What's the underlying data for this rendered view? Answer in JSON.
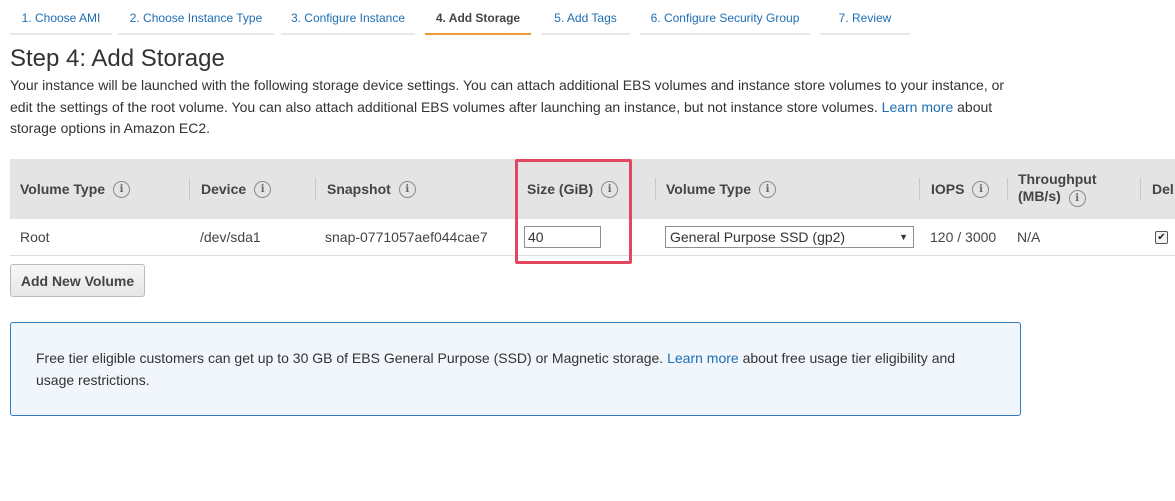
{
  "wizard": {
    "steps": [
      {
        "label": "1. Choose AMI"
      },
      {
        "label": "2. Choose Instance Type"
      },
      {
        "label": "3. Configure Instance"
      },
      {
        "label": "4. Add Storage"
      },
      {
        "label": "5. Add Tags"
      },
      {
        "label": "6. Configure Security Group"
      },
      {
        "label": "7. Review"
      }
    ],
    "active_index": 3
  },
  "page": {
    "title": "Step 4: Add Storage",
    "intro_text_1": "Your instance will be launched with the following storage device settings. You can attach additional EBS volumes and instance store volumes to your instance, or edit the settings of the root volume. You can also attach additional EBS volumes after launching an instance, but not instance store volumes.",
    "intro_link": "Learn more",
    "intro_text_2": "about storage options in Amazon EC2."
  },
  "table": {
    "headers": {
      "volume_type": "Volume Type",
      "device": "Device",
      "snapshot": "Snapshot",
      "size": "Size (GiB)",
      "ebs_volume_type": "Volume Type",
      "iops": "IOPS",
      "throughput_1": "Throughput",
      "throughput_2": "(MB/s)",
      "delete": "Del"
    },
    "row": {
      "volume_type": "Root",
      "device": "/dev/sda1",
      "snapshot": "snap-0771057aef044cae7",
      "size": "40",
      "ebs_volume_type": "General Purpose SSD (gp2)",
      "iops": "120 / 3000",
      "throughput": "N/A",
      "delete_on_termination": true
    }
  },
  "buttons": {
    "add_new_volume": "Add New Volume"
  },
  "notice": {
    "text_1": "Free tier eligible customers can get up to 30 GB of EBS General Purpose (SSD) or Magnetic storage.",
    "link": "Learn more",
    "text_2": "about free usage tier eligibility and usage restrictions."
  },
  "icons": {
    "info": "info-circle-icon",
    "dropdown": "caret-down-icon",
    "check": "check-icon"
  },
  "colors": {
    "link": "#1e6eb4",
    "active_tab_underline": "#ec9a33",
    "highlight": "#e2475f",
    "notice_border": "#2f79bf",
    "notice_bg": "#f0f6fb"
  }
}
